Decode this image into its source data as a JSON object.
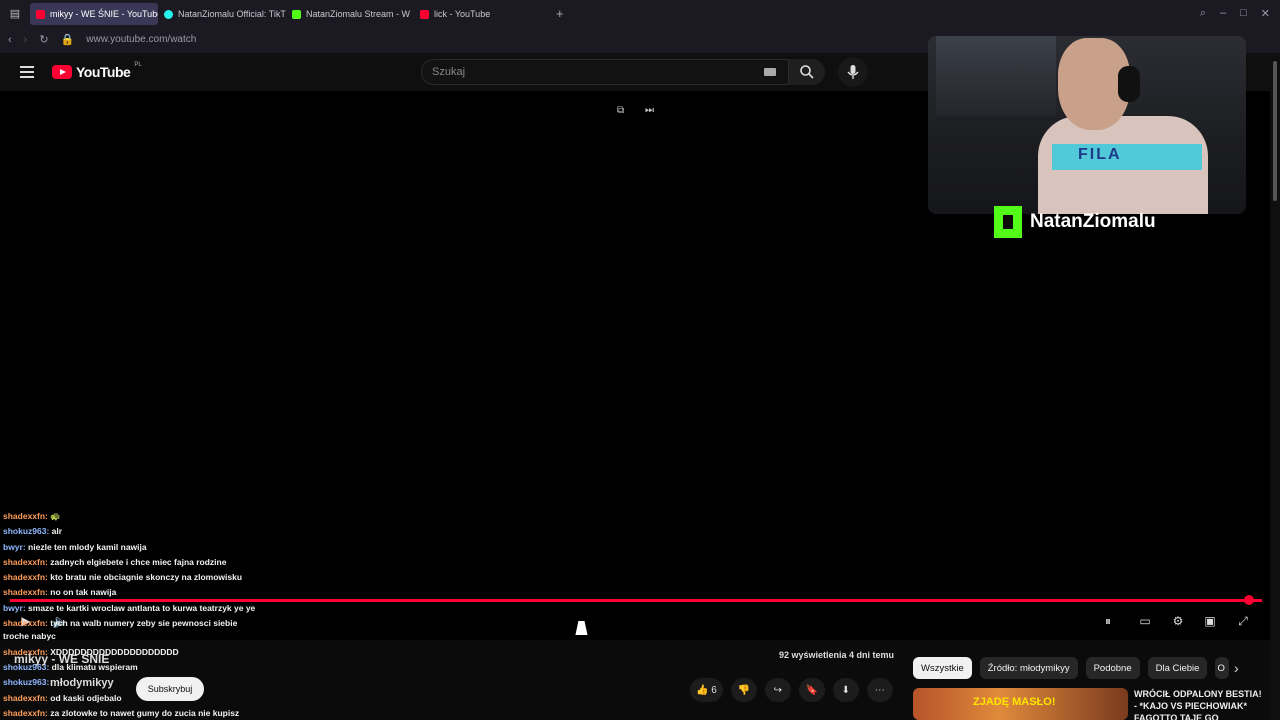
{
  "browser": {
    "tabs": [
      {
        "title": "mikyy - WE ŚNIE - YouTube",
        "active": true,
        "favicon": "youtube-icon"
      },
      {
        "title": "NatanZiomalu Official: TikT",
        "active": false,
        "favicon": "tiktok-icon"
      },
      {
        "title": "NatanZiomalu Stream - W",
        "active": false,
        "favicon": "kick-icon"
      },
      {
        "title": "lick - YouTube",
        "active": false,
        "favicon": "youtube-icon"
      }
    ],
    "url": "www.youtube.com/watch"
  },
  "youtube": {
    "logo_text": "YouTube",
    "region": "PL",
    "search_placeholder": "Szukaj",
    "video_title": "mikyy - WE ŚNIE",
    "channel": "młodymikyy",
    "subscribe_label": "Subskrybuj",
    "views": "92 wyświetlenia  4 dni temu",
    "likes": "6",
    "chips": [
      "Wszystkie",
      "Źródło: młodymikyy",
      "Podobne",
      "Dla Ciebie",
      "O"
    ],
    "recommendation": {
      "thumb_text": "ZJADĘ MASŁO!",
      "title": "WRÓCIŁ ODPALONY BESTIA! - *KAJO VS PIECHOWIAK* FAGOTTO TAJE GO"
    }
  },
  "webcam": {
    "streamer": "NatanZiomalu",
    "shirt_text": "FILA"
  },
  "chat": [
    {
      "user": "shadexxfn:",
      "msg": "🐢",
      "color": "orange"
    },
    {
      "user": "shokuz963:",
      "msg": "alr",
      "color": "blue"
    },
    {
      "user": "bwyr:",
      "msg": "niezle ten mlody kamil nawija",
      "color": "blue"
    },
    {
      "user": "shadexxfn:",
      "msg": "zadnych elgiebete i chce miec fajna rodzine",
      "color": "orange"
    },
    {
      "user": "shadexxfn:",
      "msg": "kto bratu nie obciagnie skonczy na zlomowisku",
      "color": "orange"
    },
    {
      "user": "shadexxfn:",
      "msg": "no on tak nawija",
      "color": "orange"
    },
    {
      "user": "bwyr:",
      "msg": "smaze te kartki wroclaw antlanta to kurwa teatrzyk ye ye",
      "color": "blue"
    },
    {
      "user": "shadexxfn:",
      "msg": "tych na walb numery zeby sie pewnosci siebie",
      "color": "orange"
    },
    {
      "user": "",
      "msg": "troche nabyc",
      "color": "orange"
    },
    {
      "user": "shadexxfn:",
      "msg": "XDDDDDDDDDDDDDDDDDDDD",
      "color": "orange"
    },
    {
      "user": "shokuz963:",
      "msg": "dla klimatu wspieram",
      "color": "blue"
    },
    {
      "user": "shokuz963:",
      "msg": "",
      "color": "blue"
    },
    {
      "user": "shadexxfn:",
      "msg": "od kaski odjebalo",
      "color": "orange"
    },
    {
      "user": "shadexxfn:",
      "msg": "za zlotowke to nawet gumy do zucia nie kupisz",
      "color": "orange"
    }
  ],
  "colors": {
    "accent": "#ff0033",
    "kick": "#53fc18",
    "chat_orange": "#ff9d5a",
    "chat_blue": "#8fb7ff"
  }
}
